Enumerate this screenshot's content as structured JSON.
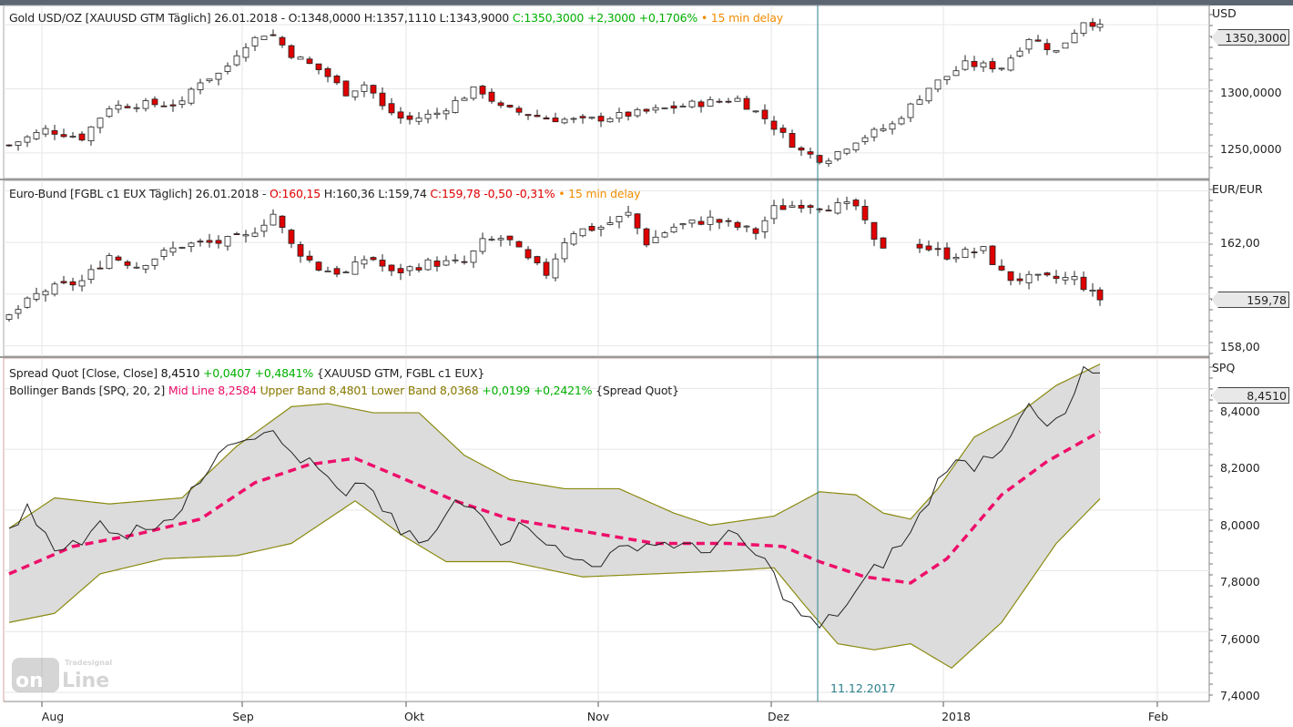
{
  "panels": {
    "gold": {
      "title": "Gold USD/OZ [XAUUSD GTM Täglich] 26.01.2018 -",
      "open": "O:1348,0000",
      "high": "H:1357,1110",
      "low": "L:1343,9000",
      "close": "C:1350,3000",
      "change": "+2,3000",
      "change_pct": "+0,1706%",
      "delay": "• 15 min delay",
      "unit": "USD",
      "ticks": [
        "1300,0000",
        "1250,0000"
      ],
      "last": "1350,3000"
    },
    "bund": {
      "title": "Euro-Bund [FGBL c1 EUX Täglich] 26.01.2018 -",
      "open": "O:160,15",
      "high": "H:160,36",
      "low": "L:159,74",
      "close": "C:159,78",
      "change": "-0,50",
      "change_pct": "-0,31%",
      "delay": "• 15 min delay",
      "unit": "EUR/EUR",
      "ticks": [
        "162,00",
        "158,00"
      ],
      "last": "159,78"
    },
    "spread": {
      "line1_label": "Spread Quot [Close, Close]",
      "value": "8,4510",
      "change": "+0,0407",
      "change_pct": "+0,4841%",
      "line1_suffix": "{XAUUSD GTM, FGBL c1 EUX}",
      "line2_label": "Bollinger Bands [SPQ, 20, 2]",
      "mid": "Mid Line 8,2584",
      "upper": "Upper Band 8,4801",
      "lower": "Lower Band 8,0368",
      "bb_change": "+0,0199",
      "bb_change_pct": "+0,2421%",
      "line2_suffix": "{Spread Quot}",
      "unit": "SPQ",
      "ticks": [
        "8,4000",
        "8,2000",
        "8,0000",
        "7,8000",
        "7,6000",
        "7,4000"
      ],
      "last": "8,4510"
    }
  },
  "xaxis": [
    "Aug",
    "Sep",
    "Okt",
    "Nov",
    "Dez",
    "2018",
    "Feb"
  ],
  "crosshair_label": "11.12.2017",
  "logo_text": "Tradesignal online",
  "colors": {
    "up": "#ffffff",
    "down": "#e00000",
    "mid": "#ee0f6a",
    "band": "#8a8a10",
    "band_fill": "#dcdcdc",
    "crosshair": "#2a7f8a"
  },
  "chart_data": [
    {
      "type": "candlestick",
      "name": "Gold USD/OZ",
      "ylim": [
        1230,
        1365
      ],
      "xunit": "trading day",
      "close_keypoints": [
        [
          0,
          1256
        ],
        [
          4,
          1268
        ],
        [
          8,
          1262
        ],
        [
          11,
          1286
        ],
        [
          14,
          1288
        ],
        [
          19,
          1288
        ],
        [
          20.5,
          1305
        ],
        [
          23.5,
          1313
        ],
        [
          25.5,
          1333
        ],
        [
          28.5,
          1345
        ],
        [
          31,
          1327
        ],
        [
          34.5,
          1313
        ],
        [
          37,
          1297
        ],
        [
          39.5,
          1305
        ],
        [
          40.5,
          1288
        ],
        [
          43.5,
          1275
        ],
        [
          47,
          1281
        ],
        [
          51.5,
          1301
        ],
        [
          54,
          1285
        ],
        [
          59,
          1277
        ],
        [
          63,
          1275
        ],
        [
          69,
          1281
        ],
        [
          75,
          1288
        ],
        [
          80,
          1292
        ],
        [
          83,
          1277
        ],
        [
          86.8,
          1252
        ],
        [
          89.5,
          1244
        ],
        [
          93,
          1260
        ],
        [
          97,
          1272
        ],
        [
          101,
          1301
        ],
        [
          105,
          1319
        ],
        [
          109,
          1317
        ],
        [
          112,
          1340
        ],
        [
          115,
          1329
        ],
        [
          118,
          1353
        ],
        [
          119.8,
          1350.3
        ]
      ]
    },
    {
      "type": "candlestick",
      "name": "Euro-Bund",
      "ylim": [
        157.6,
        164.4
      ],
      "xunit": "trading day",
      "close_keypoints": [
        [
          0,
          159.13
        ],
        [
          3.5,
          160.1
        ],
        [
          8,
          160.5
        ],
        [
          11,
          161.5
        ],
        [
          14,
          161.1
        ],
        [
          19,
          161.9
        ],
        [
          23,
          162.0
        ],
        [
          26,
          162.2
        ],
        [
          29,
          163.1
        ],
        [
          31,
          161.9
        ],
        [
          34,
          161.0
        ],
        [
          37,
          160.8
        ],
        [
          39.5,
          161.5
        ],
        [
          42,
          160.8
        ],
        [
          46,
          161.2
        ],
        [
          50,
          161.2
        ],
        [
          52,
          162.0
        ],
        [
          54.5,
          162.2
        ],
        [
          57,
          161.3
        ],
        [
          59,
          160.8
        ],
        [
          61.5,
          162.4
        ],
        [
          65,
          162.6
        ],
        [
          68,
          163.1
        ],
        [
          70,
          162.0
        ],
        [
          73,
          162.6
        ],
        [
          77,
          162.9
        ],
        [
          82,
          162.4
        ],
        [
          84,
          163.3
        ],
        [
          87,
          163.5
        ],
        [
          90,
          163.4
        ],
        [
          93,
          163.4
        ],
        [
          95,
          162.0
        ],
        [
          96.5,
          161.8
        ],
        [
          100,
          161.9
        ],
        [
          103,
          161.5
        ],
        [
          107,
          161.7
        ],
        [
          109.5,
          160.6
        ],
        [
          113,
          160.6
        ],
        [
          117,
          160.6
        ],
        [
          119.8,
          159.78
        ]
      ],
      "gap_days": [
        97,
        99
      ]
    },
    {
      "type": "line",
      "name": "Spread Quot",
      "ylim": [
        7.37,
        8.5
      ],
      "series": [
        {
          "name": "Spread Quot",
          "keypoints": [
            [
              0,
              7.94
            ],
            [
              2,
              8.0
            ],
            [
              5,
              7.89
            ],
            [
              8,
              7.88
            ],
            [
              10,
              7.96
            ],
            [
              13,
              7.92
            ],
            [
              19,
              8.0
            ],
            [
              21,
              8.1
            ],
            [
              23.5,
              8.23
            ],
            [
              26,
              8.24
            ],
            [
              28,
              8.27
            ],
            [
              31,
              8.19
            ],
            [
              34,
              8.13
            ],
            [
              37,
              8.03
            ],
            [
              39,
              8.1
            ],
            [
              43,
              7.92
            ],
            [
              46,
              7.89
            ],
            [
              49,
              8.02
            ],
            [
              52,
              8.0
            ],
            [
              54,
              7.9
            ],
            [
              57,
              7.96
            ],
            [
              61,
              7.84
            ],
            [
              65,
              7.83
            ],
            [
              69,
              7.89
            ],
            [
              73,
              7.89
            ],
            [
              76,
              7.86
            ],
            [
              79,
              7.92
            ],
            [
              83,
              7.83
            ],
            [
              86,
              7.68
            ],
            [
              89,
              7.61
            ],
            [
              92,
              7.69
            ],
            [
              95,
              7.8
            ],
            [
              99,
              7.92
            ],
            [
              103,
              8.15
            ],
            [
              106,
              8.15
            ],
            [
              109,
              8.21
            ],
            [
              111.5,
              8.34
            ],
            [
              114,
              8.27
            ],
            [
              116,
              8.31
            ],
            [
              118,
              8.45
            ],
            [
              119.8,
              8.451
            ]
          ]
        },
        {
          "name": "Mid Line",
          "keypoints": [
            [
              0,
              7.79
            ],
            [
              7,
              7.88
            ],
            [
              14,
              7.92
            ],
            [
              21,
              7.97
            ],
            [
              27,
              8.09
            ],
            [
              33,
              8.15
            ],
            [
              38,
              8.17
            ],
            [
              42,
              8.12
            ],
            [
              49,
              8.03
            ],
            [
              55,
              7.97
            ],
            [
              63,
              7.93
            ],
            [
              71,
              7.89
            ],
            [
              79,
              7.89
            ],
            [
              85,
              7.88
            ],
            [
              89,
              7.83
            ],
            [
              94,
              7.78
            ],
            [
              99,
              7.76
            ],
            [
              103,
              7.84
            ],
            [
              109,
              8.05
            ],
            [
              114,
              8.16
            ],
            [
              119.8,
              8.258
            ]
          ]
        },
        {
          "name": "Upper Band",
          "keypoints": [
            [
              0,
              7.94
            ],
            [
              5,
              8.04
            ],
            [
              11,
              8.02
            ],
            [
              19,
              8.04
            ],
            [
              25,
              8.21
            ],
            [
              31,
              8.34
            ],
            [
              35,
              8.35
            ],
            [
              40,
              8.32
            ],
            [
              45,
              8.32
            ],
            [
              50,
              8.18
            ],
            [
              55,
              8.1
            ],
            [
              61,
              8.07
            ],
            [
              67,
              8.07
            ],
            [
              73,
              7.99
            ],
            [
              77,
              7.95
            ],
            [
              84,
              7.98
            ],
            [
              89,
              8.06
            ],
            [
              93,
              8.05
            ],
            [
              96,
              7.99
            ],
            [
              99,
              7.97
            ],
            [
              102,
              8.07
            ],
            [
              106,
              8.24
            ],
            [
              111,
              8.32
            ],
            [
              115,
              8.41
            ],
            [
              119.8,
              8.48
            ]
          ]
        },
        {
          "name": "Lower Band",
          "keypoints": [
            [
              0,
              7.63
            ],
            [
              5,
              7.66
            ],
            [
              10,
              7.79
            ],
            [
              17,
              7.84
            ],
            [
              25,
              7.85
            ],
            [
              31,
              7.89
            ],
            [
              38,
              8.03
            ],
            [
              43,
              7.92
            ],
            [
              48,
              7.83
            ],
            [
              55,
              7.83
            ],
            [
              63,
              7.78
            ],
            [
              71,
              7.79
            ],
            [
              79,
              7.8
            ],
            [
              84,
              7.81
            ],
            [
              87,
              7.7
            ],
            [
              91,
              7.56
            ],
            [
              95,
              7.54
            ],
            [
              99,
              7.56
            ],
            [
              103.5,
              7.48
            ],
            [
              109,
              7.63
            ],
            [
              115,
              7.89
            ],
            [
              119.8,
              8.037
            ]
          ]
        }
      ]
    }
  ],
  "xaxis_ticks_day": [
    3.6,
    25.6,
    43.6,
    64.7,
    83.7,
    102.6,
    126.1
  ],
  "crosshair_day": 88.8
}
